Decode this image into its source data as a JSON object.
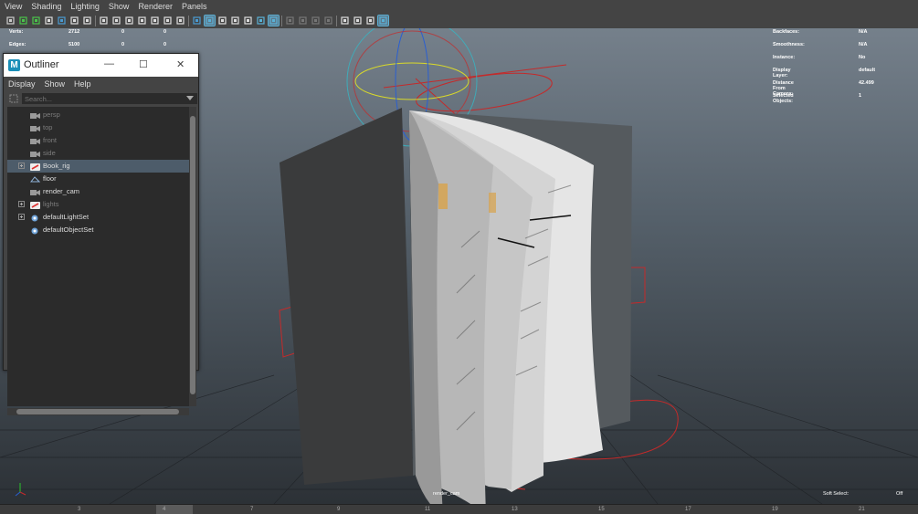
{
  "menubar": [
    "View",
    "Shading",
    "Lighting",
    "Show",
    "Renderer",
    "Panels"
  ],
  "toolbar": {
    "icons": [
      "camera-icon",
      "select-camera-icon",
      "camera-attributes-icon",
      "bookmark-icon",
      "image-plane-icon",
      "grease-pencil-icon",
      "pen-icon",
      "grid-icon",
      "film-gate-icon",
      "resolution-gate-icon",
      "gate-mask-icon",
      "field-chart-icon",
      "safe-action-icon",
      "safe-title-icon",
      "wireframe-icon",
      "smooth-shade-icon",
      "default-material-icon",
      "use-lights-icon",
      "shadows-icon",
      "textured-icon",
      "isolate-icon",
      "ambient-occlusion-icon",
      "motion-blur-icon",
      "anti-alias-icon",
      "depth-of-field-icon",
      "xray-icon",
      "xray-joints-icon",
      "backface-icon",
      "stereo-icon"
    ]
  },
  "hud_left": [
    {
      "label": "Verts:",
      "v1": "2712",
      "v2": "0",
      "v3": "0"
    },
    {
      "label": "Edges:",
      "v1": "5100",
      "v2": "0",
      "v3": "0"
    }
  ],
  "hud_right": [
    {
      "label": "Backfaces:",
      "value": "N/A"
    },
    {
      "label": "Smoothness:",
      "value": "N/A"
    },
    {
      "label": "Instance:",
      "value": "No"
    },
    {
      "label": "Display Layer:",
      "value": "default"
    },
    {
      "label": "Distance From Camera:",
      "value": "42.499"
    },
    {
      "label": "Selected Objects:",
      "value": "1"
    }
  ],
  "viewport": {
    "camera_label": "render_cam",
    "soft_select_label": "Soft Select:",
    "soft_select_value": "Off"
  },
  "timeline": {
    "ticks": [
      "3",
      "4",
      "7",
      "9",
      "11",
      "13",
      "15",
      "17",
      "19",
      "21"
    ]
  },
  "outliner": {
    "title": "Outliner",
    "menu": [
      "Display",
      "Show",
      "Help"
    ],
    "search_placeholder": "Search...",
    "items": [
      {
        "name": "persp",
        "icon": "camera-icon",
        "expandable": false,
        "style": "dim"
      },
      {
        "name": "top",
        "icon": "camera-icon",
        "expandable": false,
        "style": "dim"
      },
      {
        "name": "front",
        "icon": "camera-icon",
        "expandable": false,
        "style": "dim"
      },
      {
        "name": "side",
        "icon": "camera-icon",
        "expandable": false,
        "style": "dim"
      },
      {
        "name": "Book_rig",
        "icon": "rig-icon",
        "expandable": true,
        "style": "bright",
        "selected": true
      },
      {
        "name": "floor",
        "icon": "mesh-icon",
        "expandable": false,
        "style": "bright"
      },
      {
        "name": "render_cam",
        "icon": "camera-icon",
        "expandable": false,
        "style": "bright"
      },
      {
        "name": "lights",
        "icon": "rig-icon",
        "expandable": true,
        "style": "dim"
      },
      {
        "name": "defaultLightSet",
        "icon": "set-icon",
        "expandable": true,
        "style": "bright"
      },
      {
        "name": "defaultObjectSet",
        "icon": "set-icon",
        "expandable": false,
        "style": "bright"
      }
    ]
  }
}
